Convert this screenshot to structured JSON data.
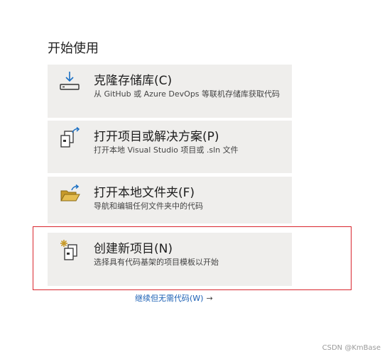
{
  "section_title": "开始使用",
  "cards": [
    {
      "title": "克隆存储库(C)",
      "description": "从 GitHub 或 Azure DevOps 等联机存储库获取代码",
      "icon": "clone-download-icon"
    },
    {
      "title": "打开项目或解决方案(P)",
      "description": "打开本地 Visual Studio 项目或 .sln 文件",
      "icon": "open-project-icon"
    },
    {
      "title": "打开本地文件夹(F)",
      "description": "导航和编辑任何文件夹中的代码",
      "icon": "open-folder-icon"
    },
    {
      "title": "创建新项目(N)",
      "description": "选择具有代码基架的项目模板以开始",
      "icon": "new-project-icon"
    }
  ],
  "continue_link": "继续但无需代码(W)",
  "continue_arrow": "→",
  "watermark": "CSDN @KmBase",
  "colors": {
    "card_background": "#efeeec",
    "highlight_border": "#d9262e",
    "link": "#1a5fb4",
    "icon_accent": "#1a6fc4",
    "folder": "#c79a2a"
  }
}
